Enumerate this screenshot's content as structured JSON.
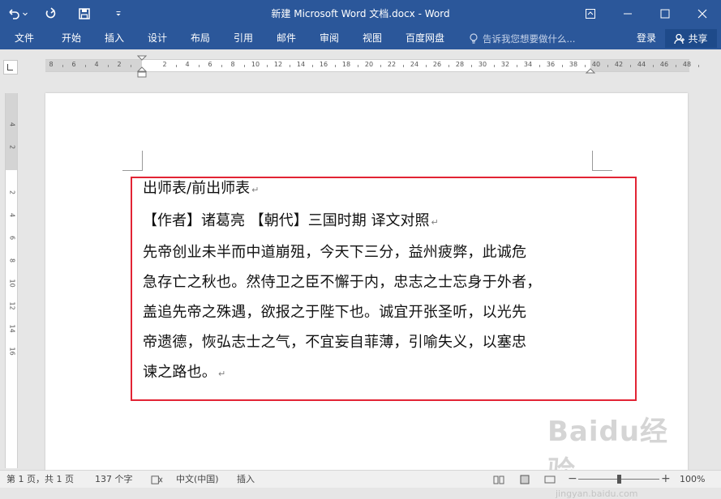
{
  "window": {
    "title": "新建 Microsoft Word 文档.docx - Word"
  },
  "ribbon": {
    "tabs": [
      "文件",
      "开始",
      "插入",
      "设计",
      "布局",
      "引用",
      "邮件",
      "审阅",
      "视图",
      "百度网盘"
    ],
    "tell_me_placeholder": "告诉我您想要做什么...",
    "login": "登录",
    "share": "共享"
  },
  "ruler": {
    "horizontal_numbers": [
      "8",
      "6",
      "4",
      "2",
      "2",
      "4",
      "6",
      "8",
      "10",
      "12",
      "14",
      "16",
      "18",
      "20",
      "22",
      "24",
      "26",
      "28",
      "30",
      "32",
      "34",
      "36",
      "38",
      "40",
      "42",
      "44",
      "46",
      "48"
    ],
    "vertical_numbers": [
      "4",
      "2",
      "2",
      "4",
      "6",
      "8",
      "10",
      "12",
      "14",
      "16"
    ]
  },
  "document": {
    "title_line": "出师表/前出师表",
    "meta_line": "【作者】诸葛亮 【朝代】三国时期 译文对照",
    "body_lines": [
      "先帝创业未半而中道崩殂，今天下三分，益州疲弊，此诚危",
      "急存亡之秋也。然侍卫之臣不懈于内，忠志之士忘身于外者，",
      "盖追先帝之殊遇，欲报之于陛下也。诚宜开张圣听，以光先",
      "帝遗德，恢弘志士之气，不宜妄自菲薄，引喻失义，以塞忠",
      "谏之路也。"
    ]
  },
  "status_bar": {
    "page": "第 1 页，共 1 页",
    "words": "137 个字",
    "language": "中文(中国)",
    "mode": "插入",
    "zoom": "100%",
    "zoom_value_percent": 100
  },
  "watermark": {
    "logo": "Baidu经验",
    "url": "jingyan.baidu.com"
  },
  "colors": {
    "ribbon": "#2b579a",
    "highlight_box": "#e22434"
  }
}
